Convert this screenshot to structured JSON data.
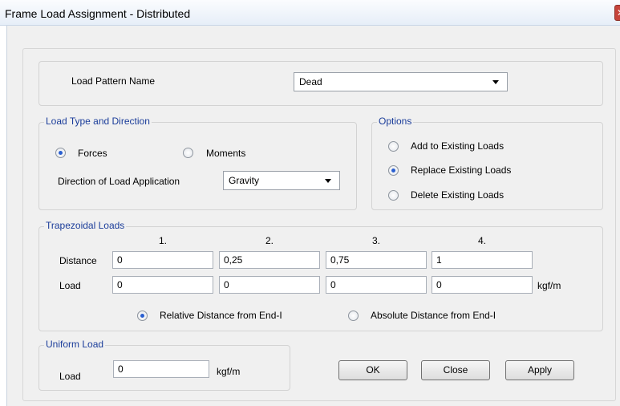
{
  "window": {
    "title": "Frame Load Assignment - Distributed",
    "close_glyph": "✕"
  },
  "load_pattern": {
    "label": "Load Pattern Name",
    "value": "Dead"
  },
  "load_type_group": {
    "title": "Load Type and Direction",
    "forces_label": "Forces",
    "moments_label": "Moments",
    "forces_selected": true,
    "direction_label": "Direction of Load Application",
    "direction_value": "Gravity"
  },
  "options_group": {
    "title": "Options",
    "add_label": "Add to Existing Loads",
    "replace_label": "Replace Existing Loads",
    "delete_label": "Delete Existing Loads",
    "selected": "replace"
  },
  "trapezoidal_group": {
    "title": "Trapezoidal Loads",
    "col_headers": [
      "1.",
      "2.",
      "3.",
      "4."
    ],
    "distance_label": "Distance",
    "load_label": "Load",
    "distances": [
      "0",
      "0,25",
      "0,75",
      "1"
    ],
    "loads": [
      "0",
      "0",
      "0",
      "0"
    ],
    "unit": "kgf/m",
    "relative_label": "Relative Distance from End-I",
    "absolute_label": "Absolute Distance from End-I",
    "relative_selected": true
  },
  "uniform_group": {
    "title": "Uniform Load",
    "load_label": "Load",
    "load_value": "0",
    "unit": "kgf/m"
  },
  "buttons": {
    "ok": "OK",
    "close": "Close",
    "apply": "Apply"
  }
}
